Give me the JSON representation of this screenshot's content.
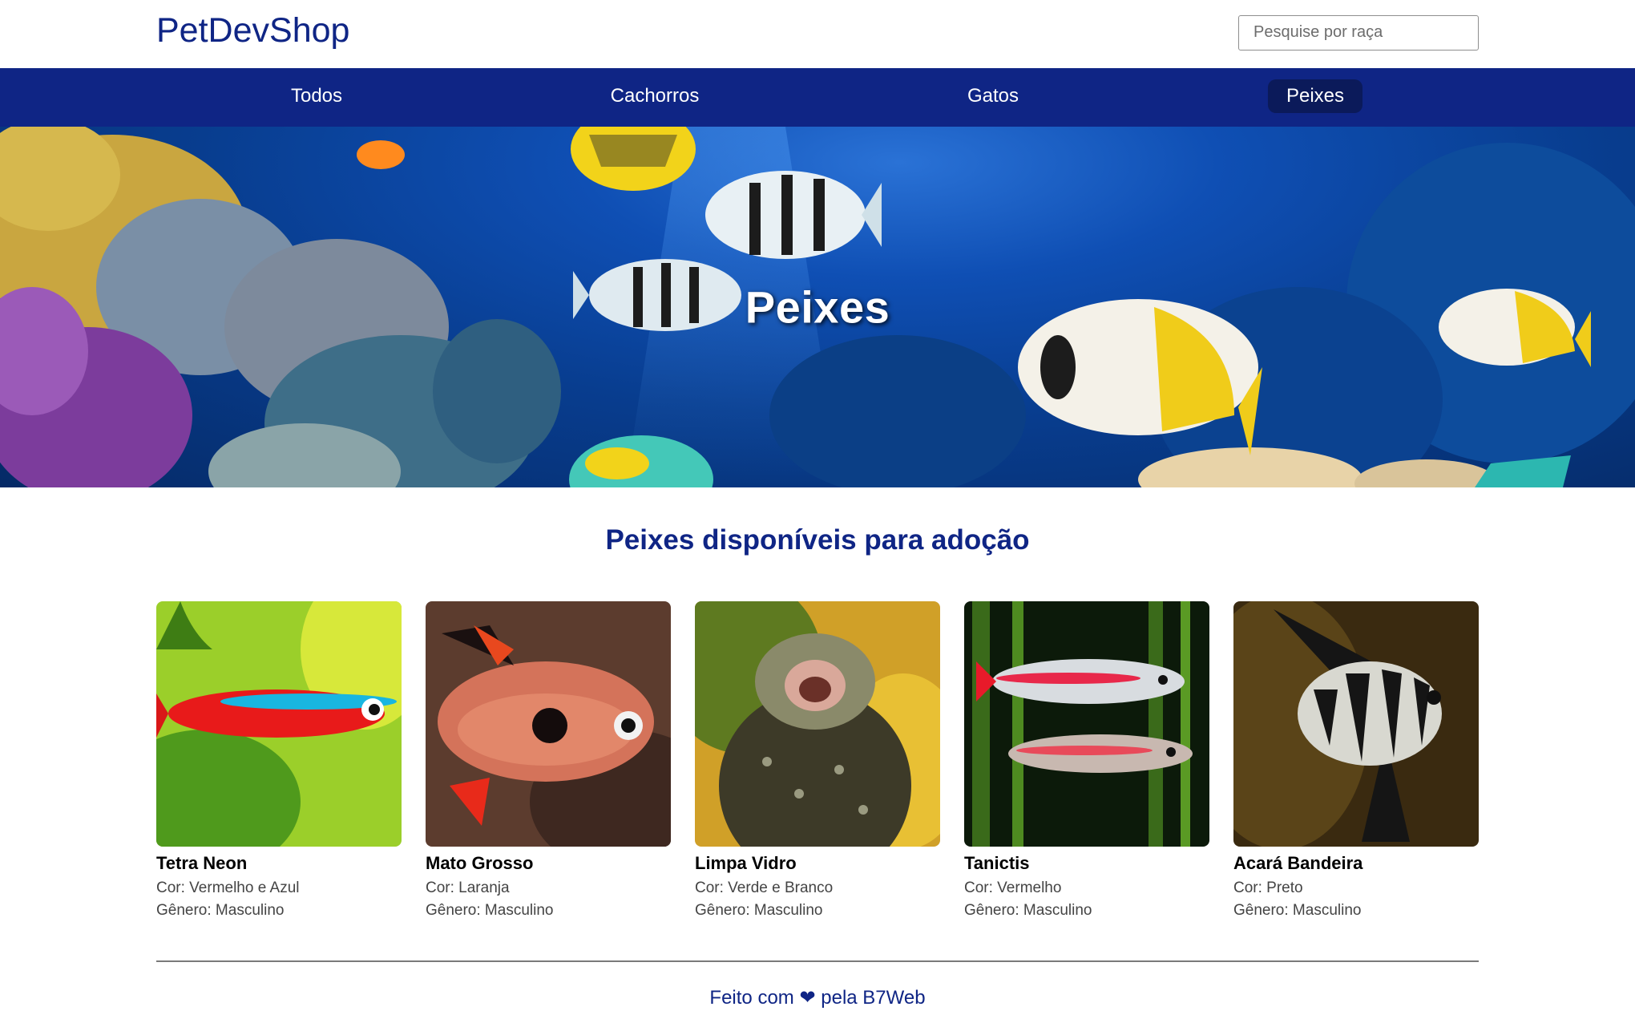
{
  "header": {
    "logo": "PetDevShop",
    "search_placeholder": "Pesquise por raça"
  },
  "nav": {
    "items": [
      {
        "label": "Todos",
        "active": false
      },
      {
        "label": "Cachorros",
        "active": false
      },
      {
        "label": "Gatos",
        "active": false
      },
      {
        "label": "Peixes",
        "active": true
      }
    ]
  },
  "banner": {
    "title": "Peixes"
  },
  "section": {
    "title": "Peixes disponíveis para adoção",
    "pets": [
      {
        "name": "Tetra Neon",
        "color": "Cor: Vermelho e Azul",
        "gender": "Gênero: Masculino"
      },
      {
        "name": "Mato Grosso",
        "color": "Cor: Laranja",
        "gender": "Gênero: Masculino"
      },
      {
        "name": "Limpa Vidro",
        "color": "Cor: Verde e Branco",
        "gender": "Gênero: Masculino"
      },
      {
        "name": "Tanictis",
        "color": "Cor: Vermelho",
        "gender": "Gênero: Masculino"
      },
      {
        "name": "Acará Bandeira",
        "color": "Cor: Preto",
        "gender": "Gênero: Masculino"
      }
    ]
  },
  "footer": {
    "prefix": "Feito com",
    "heart": "❤",
    "suffix": "pela B7Web"
  },
  "colors": {
    "brand": "#0f2585",
    "nav_active": "#0b1a5a"
  }
}
